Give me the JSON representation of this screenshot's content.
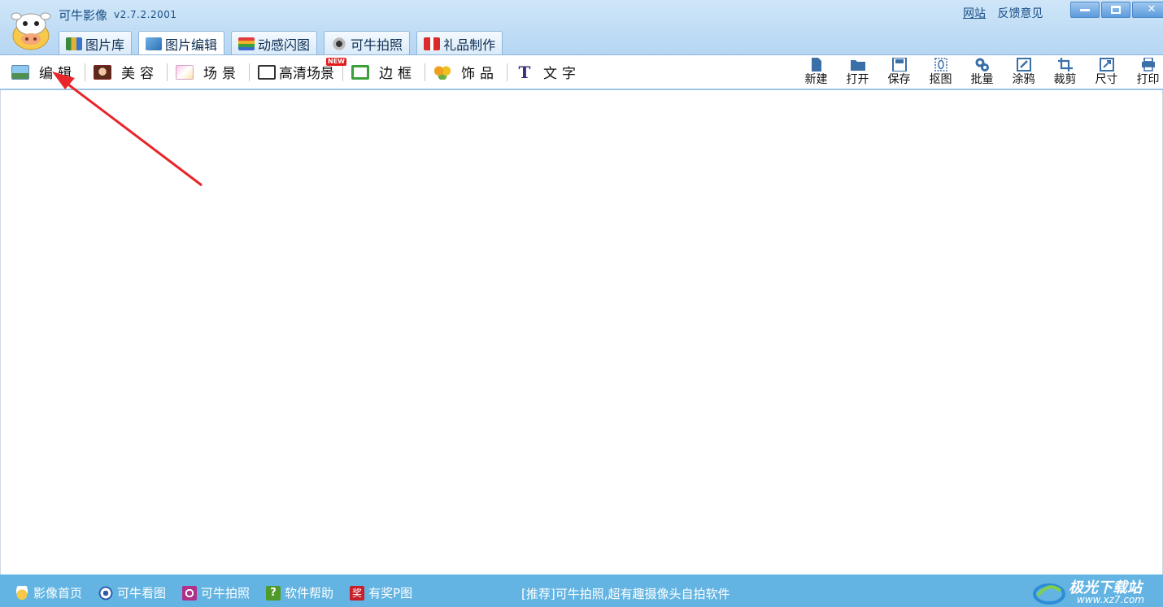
{
  "app": {
    "title": "可牛影像",
    "version": "v2.7.2.2001"
  },
  "top_links": {
    "website": "网站",
    "feedback": "反馈意见"
  },
  "window_buttons": {
    "close_glyph": "✕"
  },
  "main_tabs": [
    {
      "label": "图片库",
      "icon": "gallery-icon"
    },
    {
      "label": "图片编辑",
      "icon": "photo-edit-icon",
      "active": true
    },
    {
      "label": "动感闪图",
      "icon": "flash-icon"
    },
    {
      "label": "可牛拍照",
      "icon": "webcam-icon"
    },
    {
      "label": "礼品制作",
      "icon": "gift-icon"
    }
  ],
  "toolbar_left": [
    {
      "label": "编辑",
      "icon": "landscape-icon"
    },
    {
      "label": "美容",
      "icon": "portrait-icon"
    },
    {
      "label": "场景",
      "icon": "scene-icon"
    },
    {
      "label": "高清场景",
      "icon": "hd-scene-icon",
      "badge": "NEW"
    },
    {
      "label": "边框",
      "icon": "frame-icon"
    },
    {
      "label": "饰品",
      "icon": "ornament-icon"
    },
    {
      "label": "文字",
      "icon": "text-icon",
      "glyph": "T"
    }
  ],
  "toolbar_right": [
    {
      "label": "新建",
      "icon": "new-file-icon"
    },
    {
      "label": "打开",
      "icon": "folder-open-icon"
    },
    {
      "label": "保存",
      "icon": "save-icon"
    },
    {
      "label": "抠图",
      "icon": "cutout-icon"
    },
    {
      "label": "批量",
      "icon": "batch-gear-icon"
    },
    {
      "label": "涂鸦",
      "icon": "doodle-icon"
    },
    {
      "label": "裁剪",
      "icon": "crop-icon"
    },
    {
      "label": "尺寸",
      "icon": "resize-icon"
    },
    {
      "label": "打印",
      "icon": "print-icon"
    }
  ],
  "statusbar": {
    "items": [
      {
        "label": "影像首页",
        "icon": "cow-icon"
      },
      {
        "label": "可牛看图",
        "icon": "eye-icon"
      },
      {
        "label": "可牛拍照",
        "icon": "camera-icon"
      },
      {
        "label": "软件帮助",
        "icon": "help-icon",
        "glyph": "?"
      },
      {
        "label": "有奖P图",
        "icon": "prize-icon",
        "glyph": "奖"
      }
    ],
    "recommend": "[推荐]可牛拍照,超有趣摄像头自拍软件"
  },
  "watermark": {
    "name": "极光下载站",
    "url": "www.xz7.com"
  },
  "colors": {
    "header_text": "#1a4f86",
    "statusbar_bg": "#63b4e2",
    "arrow": "#e8262b",
    "new_badge": "#e21b1b"
  }
}
